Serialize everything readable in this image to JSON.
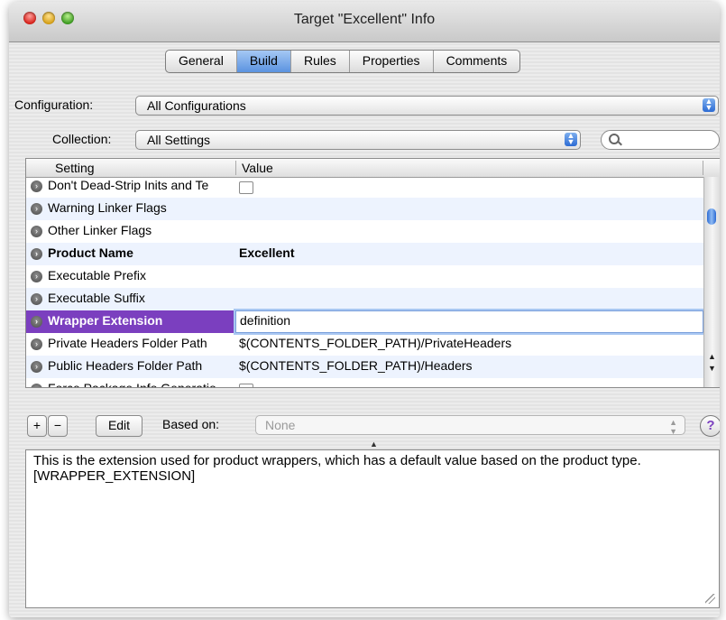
{
  "window": {
    "title": "Target \"Excellent\" Info"
  },
  "tabs": [
    "General",
    "Build",
    "Rules",
    "Properties",
    "Comments"
  ],
  "active_tab": "Build",
  "configuration": {
    "label": "Configuration:",
    "value": "All Configurations"
  },
  "collection": {
    "label": "Collection:",
    "value": "All Settings"
  },
  "table": {
    "headers": {
      "setting": "Setting",
      "value": "Value"
    },
    "rows": [
      {
        "setting": "Don't Dead-Strip Inits and Te",
        "value": ""
      },
      {
        "setting": "Warning Linker Flags",
        "value": ""
      },
      {
        "setting": "Other Linker Flags",
        "value": ""
      },
      {
        "setting": "Product Name",
        "value": "Excellent"
      },
      {
        "setting": "Executable Prefix",
        "value": ""
      },
      {
        "setting": "Executable Suffix",
        "value": ""
      },
      {
        "setting": "Wrapper Extension",
        "value": "definition"
      },
      {
        "setting": "Private Headers Folder Path",
        "value": "$(CONTENTS_FOLDER_PATH)/PrivateHeaders"
      },
      {
        "setting": "Public Headers Folder Path",
        "value": "$(CONTENTS_FOLDER_PATH)/Headers"
      },
      {
        "setting": "Force Package Info Generatio",
        "value": ""
      }
    ]
  },
  "bottom": {
    "add": "+",
    "remove": "−",
    "edit": "Edit",
    "based_on_label": "Based on:",
    "based_on_value": "None",
    "help": "?"
  },
  "description": "This is the extension used for product wrappers, which has a default value based on the product type. [WRAPPER_EXTENSION]"
}
